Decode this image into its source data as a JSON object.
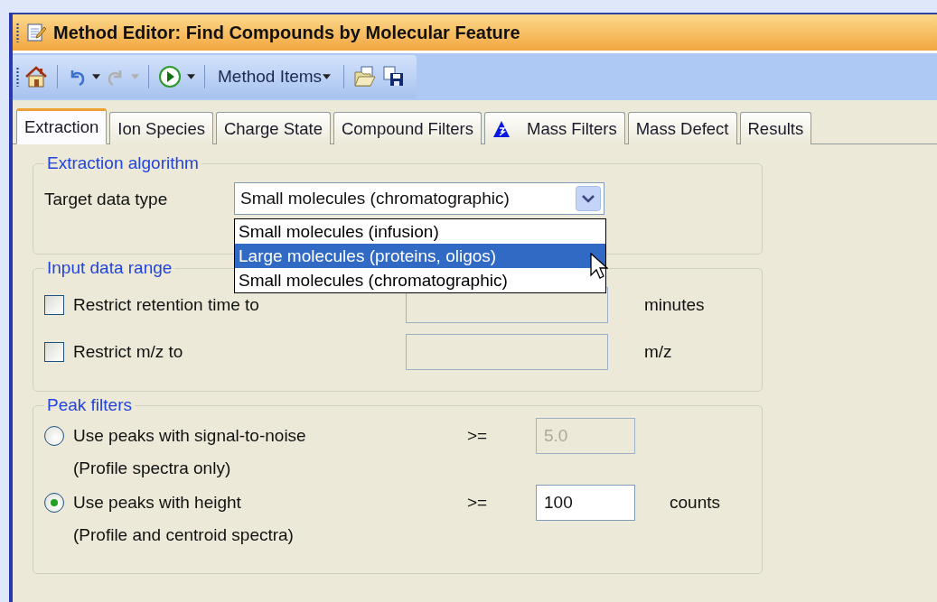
{
  "window": {
    "title": "Method Editor: Find Compounds by Molecular Feature"
  },
  "toolbar": {
    "menu_label": "Method Items",
    "redo_disabled": true
  },
  "tabs": [
    {
      "label": "Extraction",
      "selected": true
    },
    {
      "label": "Ion Species",
      "selected": false
    },
    {
      "label": "Charge State",
      "selected": false
    },
    {
      "label": "Compound Filters",
      "selected": false
    },
    {
      "label": "Mass Filters",
      "selected": false,
      "kind": "icon"
    },
    {
      "label": "Mass Defect",
      "selected": false
    },
    {
      "label": "Results",
      "selected": false
    }
  ],
  "extraction": {
    "legend": "Extraction algorithm",
    "label": "Target data type",
    "value": "Small molecules (chromatographic)",
    "expanded": true,
    "options": [
      {
        "label": "Small molecules (infusion)",
        "highlighted": false
      },
      {
        "label": "Large molecules (proteins, oligos)",
        "highlighted": true
      },
      {
        "label": "Small molecules (chromatographic)",
        "highlighted": false
      }
    ]
  },
  "input_range": {
    "legend": "Input data range",
    "rows": [
      {
        "label": "Restrict retention time to",
        "checked": false,
        "unit": "minutes"
      },
      {
        "label": "Restrict m/z to",
        "checked": false,
        "unit": "m/z"
      }
    ]
  },
  "peak_filters": {
    "legend": "Peak filters",
    "options": [
      {
        "label": "Use peaks with signal-to-noise",
        "note": "(Profile spectra only)",
        "selected": false,
        "operator": ">=",
        "value": "5.0",
        "disabled": true
      },
      {
        "label": "Use peaks with height",
        "note": "(Profile and centroid spectra)",
        "selected": true,
        "operator": ">=",
        "value": "100",
        "disabled": false,
        "unit": "counts"
      }
    ]
  }
}
